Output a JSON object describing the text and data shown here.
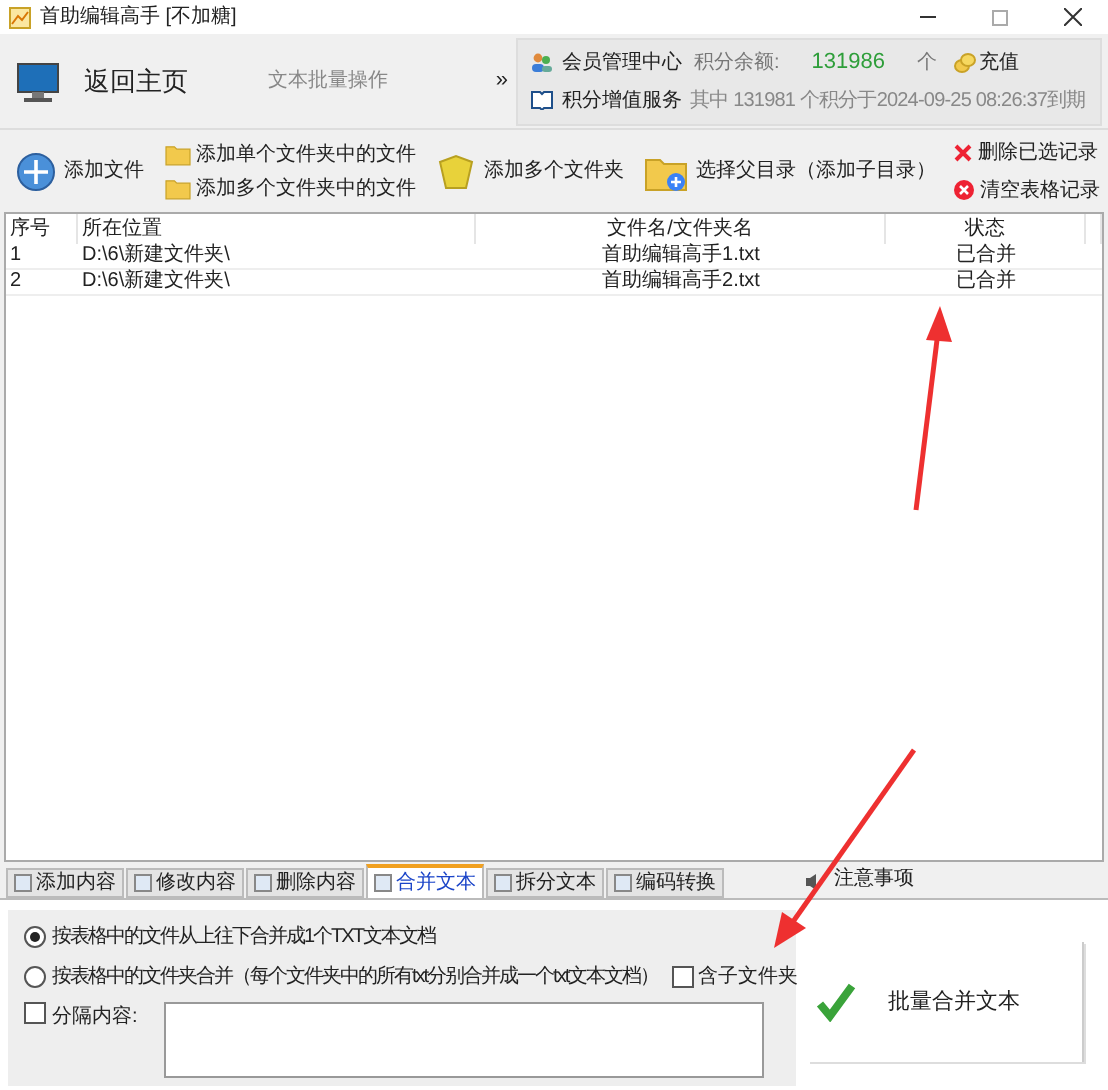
{
  "window": {
    "title": "首助编辑高手 [不加糖]"
  },
  "header": {
    "home": "返回主页",
    "section": "文本批量操作",
    "more": "»",
    "member_center": "会员管理中心",
    "balance_label": "积分余额:",
    "balance": "131986",
    "unit": "个",
    "recharge": "充值",
    "service": "积分增值服务",
    "expiry": "其中 131981 个积分于2024-09-25 08:26:37到期"
  },
  "toolbar": {
    "add_file": "添加文件",
    "add_single_folder": "添加单个文件夹中的文件",
    "add_multi_folder_files": "添加多个文件夹中的文件",
    "add_folders": "添加多个文件夹",
    "choose_parent": "选择父目录（添加子目录）",
    "delete_selected": "删除已选记录",
    "clear_table": "清空表格记录"
  },
  "table": {
    "columns": [
      "序号",
      "所在位置",
      "文件名/文件夹名",
      "状态"
    ],
    "rows": [
      [
        "1",
        "D:\\6\\新建文件夹\\",
        "首助编辑高手1.txt",
        "已合并"
      ],
      [
        "2",
        "D:\\6\\新建文件夹\\",
        "首助编辑高手2.txt",
        "已合并"
      ]
    ]
  },
  "tabs": [
    {
      "label": "添加内容",
      "selected": false
    },
    {
      "label": "修改内容",
      "selected": false
    },
    {
      "label": "删除内容",
      "selected": false
    },
    {
      "label": "合并文本",
      "selected": true
    },
    {
      "label": "拆分文本",
      "selected": false
    },
    {
      "label": "编码转换",
      "selected": false
    }
  ],
  "notice": "注意事项",
  "options": [
    {
      "label": "按表格中的文件从上往下合并成1个TXT文本文档",
      "selected": true
    },
    {
      "label": "按表格中的文件夹合并（每个文件夹中的所有txt分别合并成一个txt文本文档）",
      "selected": false
    }
  ],
  "include_subfolders": {
    "label": "含子文件夹",
    "checked": false
  },
  "separator": {
    "label": "分隔内容:",
    "checked": false
  },
  "merge_button": "批量合并文本"
}
